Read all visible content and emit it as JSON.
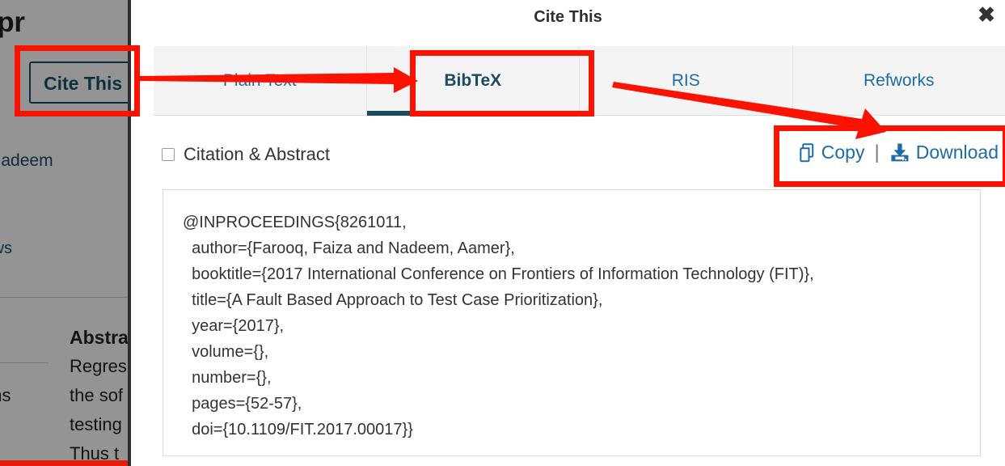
{
  "modal": {
    "title": "Cite This",
    "close_label": "✖",
    "tabs": [
      {
        "label": "Plain Text",
        "active": false
      },
      {
        "label": "BibTeX",
        "active": true
      },
      {
        "label": "RIS",
        "active": false
      },
      {
        "label": "Refworks",
        "active": false
      }
    ],
    "checkbox_label": "Citation & Abstract",
    "checkbox_checked": false,
    "actions": {
      "copy_label": "Copy",
      "separator": "|",
      "download_label": "Download"
    },
    "citation_lines": [
      "@INPROCEEDINGS{8261011,",
      "  author={Farooq, Faiza and Nadeem, Aamer},",
      "  booktitle={2017 International Conference on Frontiers of Information Technology (FIT)},",
      "  title={A Fault Based Approach to Test Case Prioritization},",
      "  year={2017},",
      "  volume={},",
      "  number={},",
      "  pages={52-57},",
      "  doi={10.1109/FIT.2017.00017}}"
    ]
  },
  "background": {
    "page_title": "sed Appr",
    "cite_button_label": "Cite This",
    "authors": "her Nadeem",
    "views_label": "Views",
    "metrics_label": "ons",
    "abstract_heading": "Abstra",
    "abstract_lines": [
      "Regres",
      "the sof",
      "testing",
      "Thus t"
    ]
  },
  "annotations": {
    "highlight_color": "#fb1200",
    "boxes": [
      {
        "name": "cite-this-button-highlight"
      },
      {
        "name": "bibtex-tab-highlight"
      },
      {
        "name": "copy-download-highlight"
      }
    ],
    "arrows": [
      {
        "name": "arrow-to-bibtex-tab"
      },
      {
        "name": "arrow-to-download"
      }
    ]
  }
}
